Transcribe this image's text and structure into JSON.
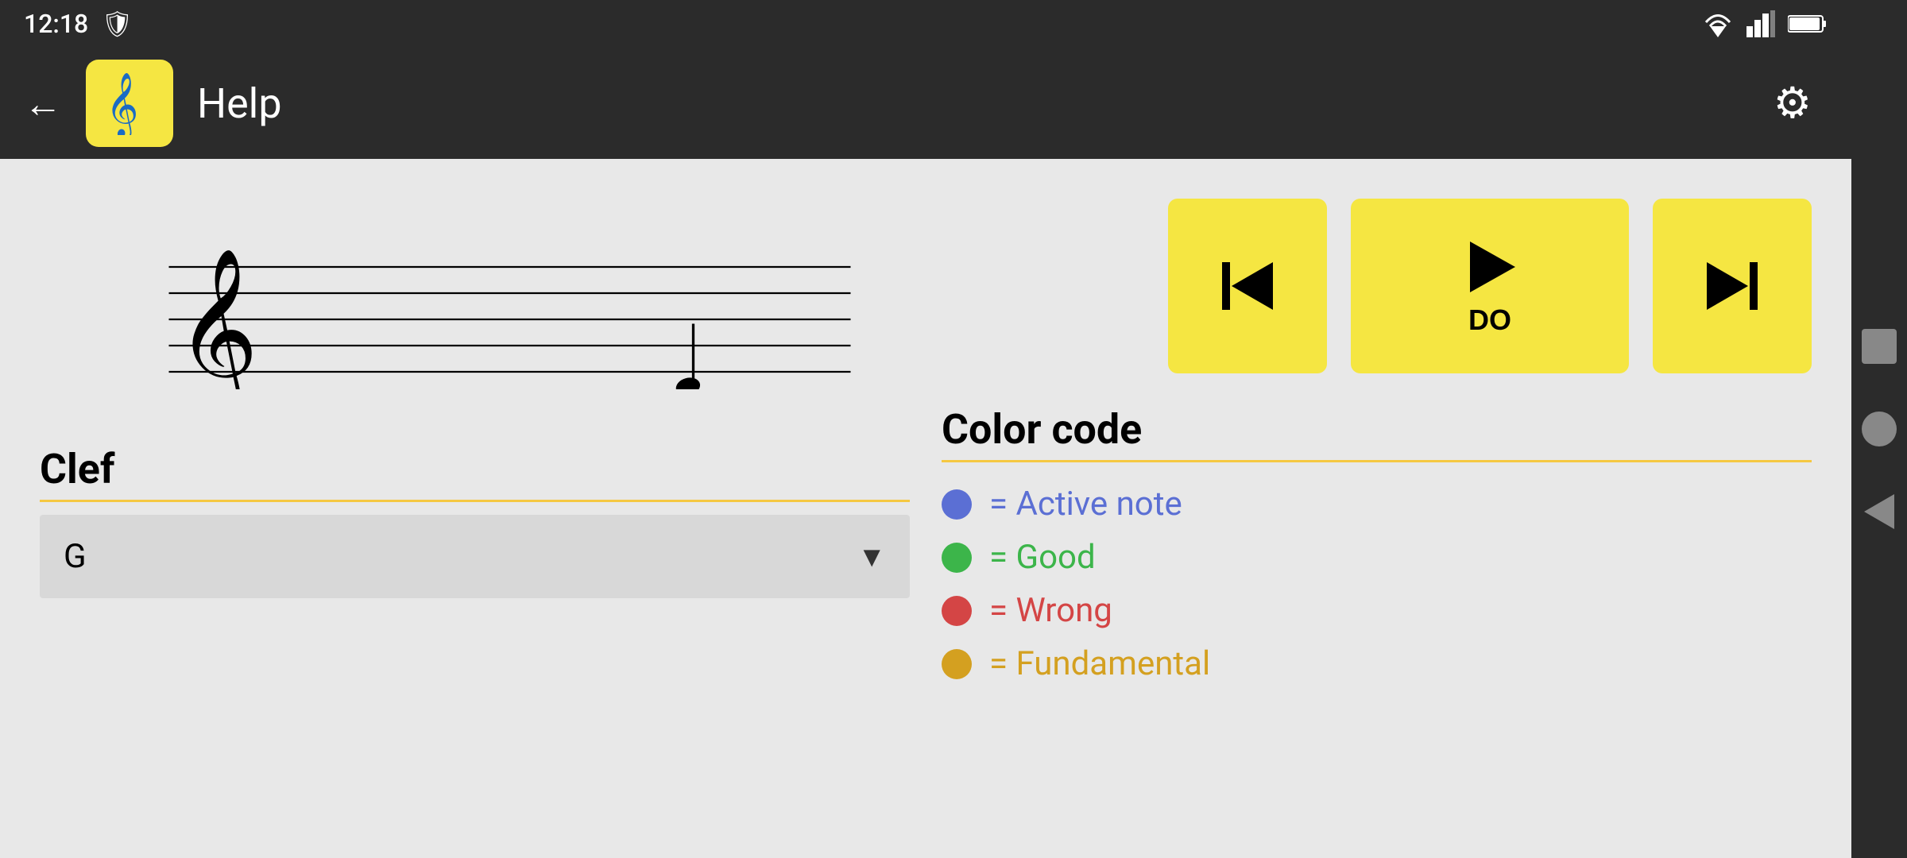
{
  "status_bar": {
    "time": "12:18",
    "wifi_icon": "wifi-icon",
    "signal_icon": "signal-icon",
    "battery_icon": "battery-icon"
  },
  "top_bar": {
    "back_label": "←",
    "app_icon_emoji": "🎵",
    "title": "Help",
    "settings_icon": "⚙"
  },
  "playback": {
    "skip_back_label": "",
    "play_label": "▶",
    "play_note": "DO",
    "skip_forward_label": ""
  },
  "clef_section": {
    "title": "Clef",
    "dropdown_value": "G",
    "dropdown_arrow": "▼"
  },
  "color_code_section": {
    "title": "Color code",
    "items": [
      {
        "dot_class": "color-dot-blue",
        "text_class": "color-text-blue",
        "text": "= Active note"
      },
      {
        "dot_class": "color-dot-green",
        "text_class": "color-text-green",
        "text": "= Good"
      },
      {
        "dot_class": "color-dot-red",
        "text_class": "color-text-red",
        "text": "= Wrong"
      },
      {
        "dot_class": "color-dot-orange",
        "text_class": "color-text-orange",
        "text": "= Fundamental"
      }
    ]
  }
}
